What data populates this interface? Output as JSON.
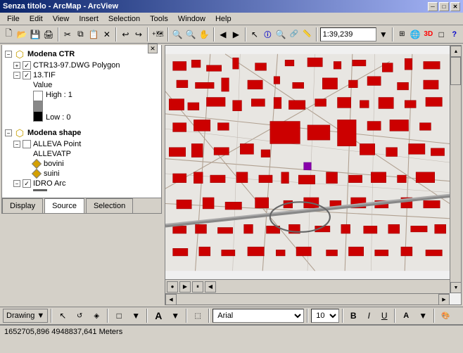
{
  "window": {
    "title": "Senza titolo - ArcMap - ArcView",
    "title_icon": "arcmap-icon"
  },
  "titlebar": {
    "minimize_label": "─",
    "maximize_label": "□",
    "close_label": "✕"
  },
  "menu": {
    "items": [
      "File",
      "Edit",
      "View",
      "Insert",
      "Selection",
      "Tools",
      "Window",
      "Help"
    ]
  },
  "toolbar1": {
    "zoom_value": "1:39,239"
  },
  "toc": {
    "groups": [
      {
        "name": "Modena CTR",
        "expanded": true,
        "children": [
          {
            "name": "CTR13-97.DWG Polygon",
            "checked": true,
            "type": "polygon"
          },
          {
            "name": "13.TIF",
            "checked": true,
            "type": "raster",
            "legend": [
              {
                "label": "Value"
              },
              {
                "label": "High : 1"
              },
              {
                "label": "Low : 0"
              }
            ]
          }
        ]
      },
      {
        "name": "Modena shape",
        "expanded": true,
        "children": [
          {
            "name": "ALLEVA Point",
            "checked": false,
            "type": "point",
            "legend_name": "ALLEVATP",
            "items": [
              {
                "label": "bovini",
                "symbol": "diamond-yellow"
              },
              {
                "label": "suini",
                "symbol": "diamond-yellow"
              }
            ]
          },
          {
            "name": "IDRO Arc",
            "checked": true,
            "type": "line"
          }
        ]
      }
    ]
  },
  "tabs": {
    "items": [
      "Display",
      "Source",
      "Selection"
    ],
    "active": "Source"
  },
  "drawing_bar": {
    "drawing_label": "Drawing",
    "font_name": "Arial",
    "font_size": "10",
    "bold": "B",
    "italic": "I",
    "underline": "U"
  },
  "status_bar": {
    "coordinates": "1652705,896  4948837,641 Meters"
  },
  "map_nav": {
    "globe_icon": "●"
  }
}
